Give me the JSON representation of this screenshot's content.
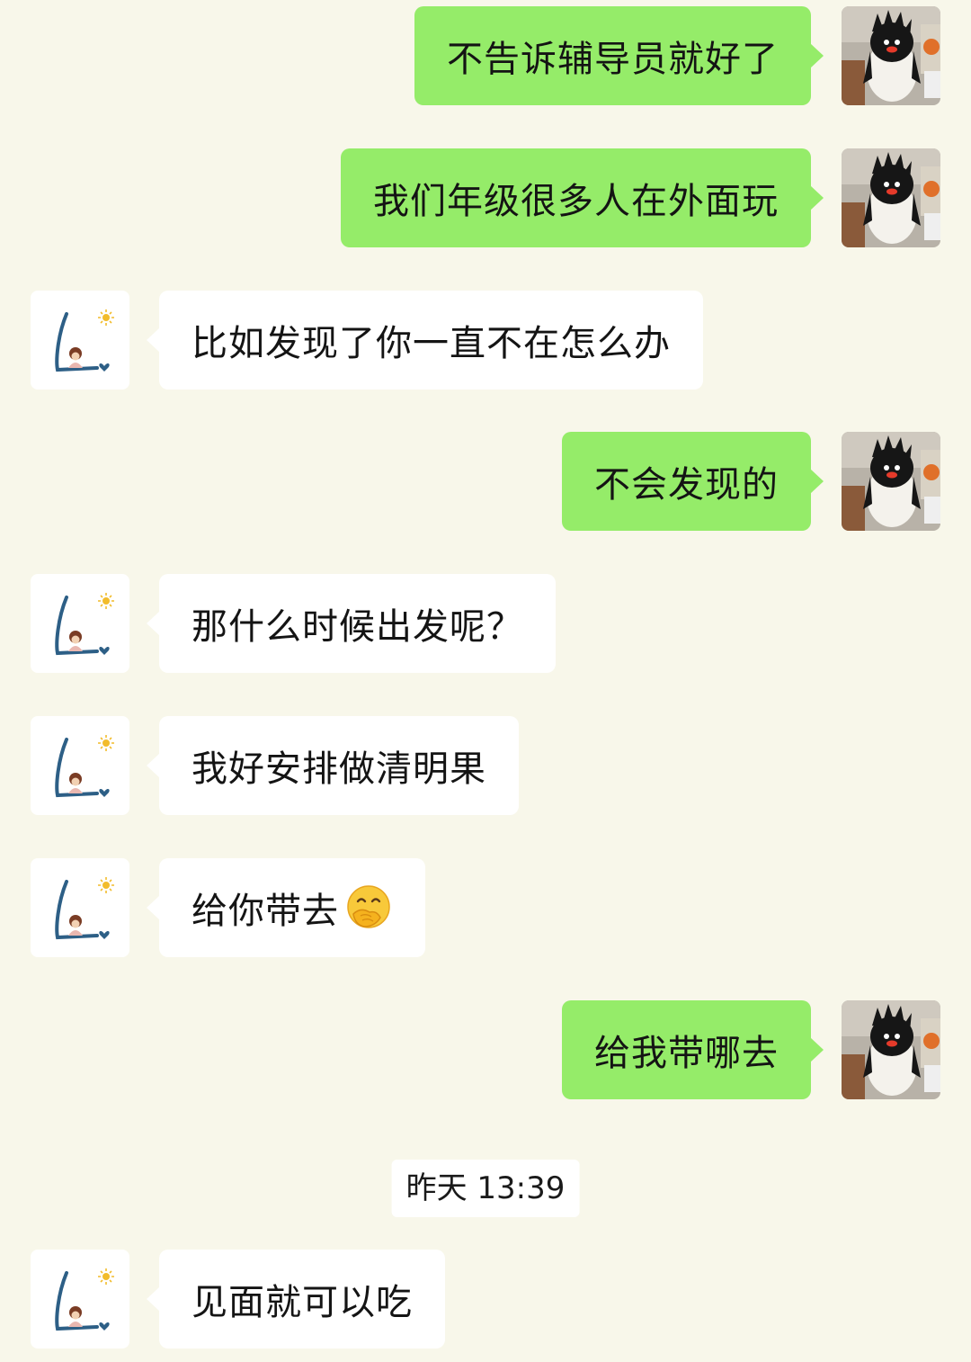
{
  "chat": {
    "timestamp": "昨天 13:39",
    "messages": [
      {
        "sender": "me",
        "text": "不告诉辅导员就好了"
      },
      {
        "sender": "me",
        "text": "我们年级很多人在外面玩"
      },
      {
        "sender": "them",
        "text": "比如发现了你一直不在怎么办"
      },
      {
        "sender": "me",
        "text": "不会发现的"
      },
      {
        "sender": "them",
        "text": "那什么时候出发呢？"
      },
      {
        "sender": "them",
        "text": "我好安排做清明果"
      },
      {
        "sender": "them",
        "text": "给你带去",
        "emoji": "face-with-hand-over-mouth-emoji"
      },
      {
        "sender": "me",
        "text": "给我带哪去"
      },
      {
        "sender": "them",
        "text": "见面就可以吃"
      }
    ]
  },
  "avatars": {
    "me": "penguin-plush-avatar",
    "them": "drawn-girl-sun-heart-avatar"
  },
  "colors": {
    "background": "#f8f7ea",
    "my_bubble": "#95ec69",
    "their_bubble": "#ffffff"
  }
}
